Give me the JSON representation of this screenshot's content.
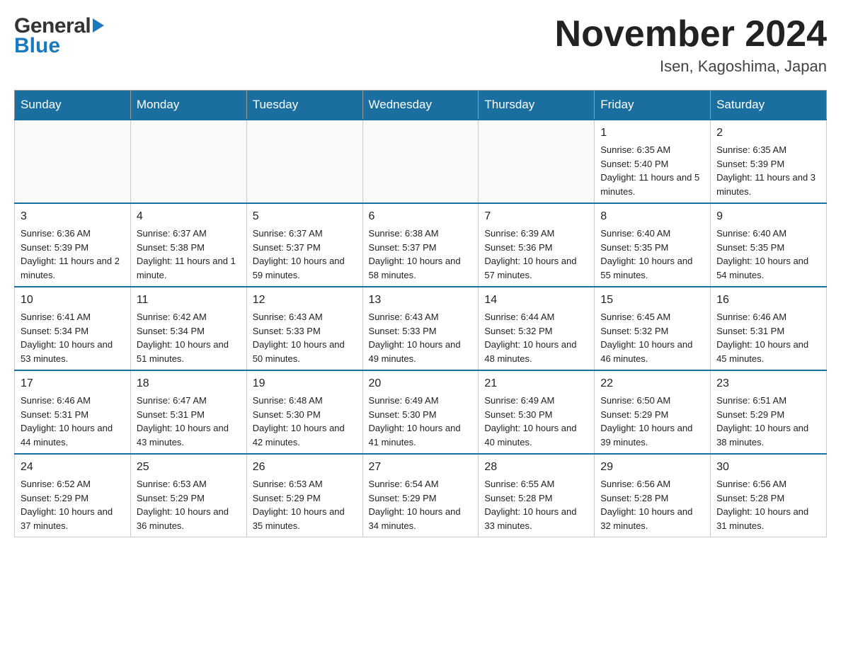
{
  "header": {
    "title": "November 2024",
    "subtitle": "Isen, Kagoshima, Japan"
  },
  "days_of_week": [
    "Sunday",
    "Monday",
    "Tuesday",
    "Wednesday",
    "Thursday",
    "Friday",
    "Saturday"
  ],
  "weeks": [
    [
      {
        "day": "",
        "info": ""
      },
      {
        "day": "",
        "info": ""
      },
      {
        "day": "",
        "info": ""
      },
      {
        "day": "",
        "info": ""
      },
      {
        "day": "",
        "info": ""
      },
      {
        "day": "1",
        "info": "Sunrise: 6:35 AM\nSunset: 5:40 PM\nDaylight: 11 hours and 5 minutes."
      },
      {
        "day": "2",
        "info": "Sunrise: 6:35 AM\nSunset: 5:39 PM\nDaylight: 11 hours and 3 minutes."
      }
    ],
    [
      {
        "day": "3",
        "info": "Sunrise: 6:36 AM\nSunset: 5:39 PM\nDaylight: 11 hours and 2 minutes."
      },
      {
        "day": "4",
        "info": "Sunrise: 6:37 AM\nSunset: 5:38 PM\nDaylight: 11 hours and 1 minute."
      },
      {
        "day": "5",
        "info": "Sunrise: 6:37 AM\nSunset: 5:37 PM\nDaylight: 10 hours and 59 minutes."
      },
      {
        "day": "6",
        "info": "Sunrise: 6:38 AM\nSunset: 5:37 PM\nDaylight: 10 hours and 58 minutes."
      },
      {
        "day": "7",
        "info": "Sunrise: 6:39 AM\nSunset: 5:36 PM\nDaylight: 10 hours and 57 minutes."
      },
      {
        "day": "8",
        "info": "Sunrise: 6:40 AM\nSunset: 5:35 PM\nDaylight: 10 hours and 55 minutes."
      },
      {
        "day": "9",
        "info": "Sunrise: 6:40 AM\nSunset: 5:35 PM\nDaylight: 10 hours and 54 minutes."
      }
    ],
    [
      {
        "day": "10",
        "info": "Sunrise: 6:41 AM\nSunset: 5:34 PM\nDaylight: 10 hours and 53 minutes."
      },
      {
        "day": "11",
        "info": "Sunrise: 6:42 AM\nSunset: 5:34 PM\nDaylight: 10 hours and 51 minutes."
      },
      {
        "day": "12",
        "info": "Sunrise: 6:43 AM\nSunset: 5:33 PM\nDaylight: 10 hours and 50 minutes."
      },
      {
        "day": "13",
        "info": "Sunrise: 6:43 AM\nSunset: 5:33 PM\nDaylight: 10 hours and 49 minutes."
      },
      {
        "day": "14",
        "info": "Sunrise: 6:44 AM\nSunset: 5:32 PM\nDaylight: 10 hours and 48 minutes."
      },
      {
        "day": "15",
        "info": "Sunrise: 6:45 AM\nSunset: 5:32 PM\nDaylight: 10 hours and 46 minutes."
      },
      {
        "day": "16",
        "info": "Sunrise: 6:46 AM\nSunset: 5:31 PM\nDaylight: 10 hours and 45 minutes."
      }
    ],
    [
      {
        "day": "17",
        "info": "Sunrise: 6:46 AM\nSunset: 5:31 PM\nDaylight: 10 hours and 44 minutes."
      },
      {
        "day": "18",
        "info": "Sunrise: 6:47 AM\nSunset: 5:31 PM\nDaylight: 10 hours and 43 minutes."
      },
      {
        "day": "19",
        "info": "Sunrise: 6:48 AM\nSunset: 5:30 PM\nDaylight: 10 hours and 42 minutes."
      },
      {
        "day": "20",
        "info": "Sunrise: 6:49 AM\nSunset: 5:30 PM\nDaylight: 10 hours and 41 minutes."
      },
      {
        "day": "21",
        "info": "Sunrise: 6:49 AM\nSunset: 5:30 PM\nDaylight: 10 hours and 40 minutes."
      },
      {
        "day": "22",
        "info": "Sunrise: 6:50 AM\nSunset: 5:29 PM\nDaylight: 10 hours and 39 minutes."
      },
      {
        "day": "23",
        "info": "Sunrise: 6:51 AM\nSunset: 5:29 PM\nDaylight: 10 hours and 38 minutes."
      }
    ],
    [
      {
        "day": "24",
        "info": "Sunrise: 6:52 AM\nSunset: 5:29 PM\nDaylight: 10 hours and 37 minutes."
      },
      {
        "day": "25",
        "info": "Sunrise: 6:53 AM\nSunset: 5:29 PM\nDaylight: 10 hours and 36 minutes."
      },
      {
        "day": "26",
        "info": "Sunrise: 6:53 AM\nSunset: 5:29 PM\nDaylight: 10 hours and 35 minutes."
      },
      {
        "day": "27",
        "info": "Sunrise: 6:54 AM\nSunset: 5:29 PM\nDaylight: 10 hours and 34 minutes."
      },
      {
        "day": "28",
        "info": "Sunrise: 6:55 AM\nSunset: 5:28 PM\nDaylight: 10 hours and 33 minutes."
      },
      {
        "day": "29",
        "info": "Sunrise: 6:56 AM\nSunset: 5:28 PM\nDaylight: 10 hours and 32 minutes."
      },
      {
        "day": "30",
        "info": "Sunrise: 6:56 AM\nSunset: 5:28 PM\nDaylight: 10 hours and 31 minutes."
      }
    ]
  ]
}
